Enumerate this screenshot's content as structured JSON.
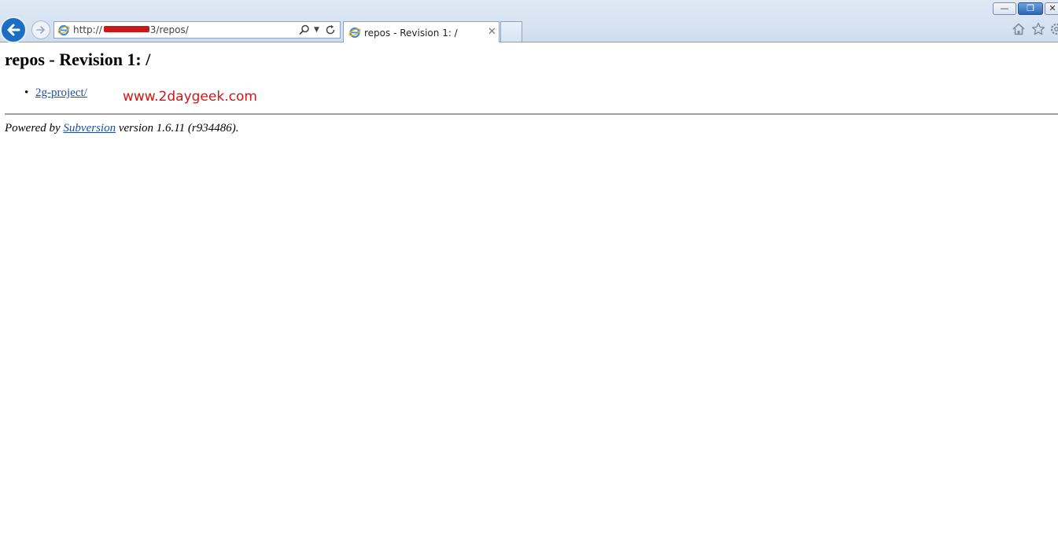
{
  "browser": {
    "address": {
      "text": "http://                3/repos/"
    },
    "tab": {
      "title": "repos - Revision 1: /",
      "close_glyph": "✕"
    },
    "window_controls": {
      "minimize": "—",
      "maximize": "❐",
      "close": "✕"
    },
    "icons": [
      "back-arrow-icon",
      "forward-arrow-icon",
      "ie-logo-icon",
      "search-icon",
      "dropdown-icon",
      "refresh-icon",
      "home-icon",
      "favorites-star-icon",
      "tools-gear-icon"
    ],
    "colors": {
      "back_button": "#1b6ec2",
      "chrome": "#dfe9f5"
    }
  },
  "page": {
    "title": "repos - Revision 1: /",
    "items": [
      {
        "label": "2g-project/"
      }
    ],
    "bullet": "•",
    "watermark": "www.2daygeek.com",
    "footer": {
      "prefix": "Powered by ",
      "link": "Subversion",
      "suffix": " version 1.6.11 (r934486)."
    },
    "colors": {
      "link": "#1a4fa8",
      "watermark": "#d11616"
    }
  }
}
